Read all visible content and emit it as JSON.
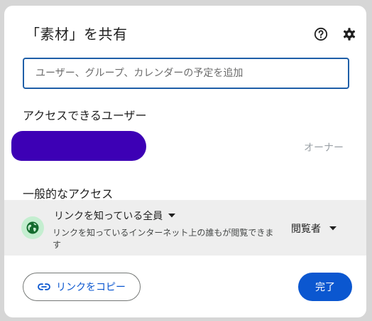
{
  "dialog": {
    "title": "「素材」を共有",
    "help_icon": "help-circle-icon",
    "settings_icon": "gear-icon"
  },
  "share_input": {
    "placeholder": "ユーザー、グループ、カレンダーの予定を追加",
    "value": ""
  },
  "people_section": {
    "heading": "アクセスできるユーザー",
    "owner_role": "オーナー"
  },
  "general_access": {
    "heading": "一般的なアクセス",
    "scope_label": "リンクを知っている全員",
    "scope_description": "リンクを知っているインターネット上の誰もが閲覧できます",
    "role_label": "閲覧者",
    "icon": "globe-icon"
  },
  "footer": {
    "copy_link_label": "リンクをコピー",
    "done_label": "完了"
  },
  "colors": {
    "accent": "#0b57d0",
    "input_border": "#1f5fa8",
    "globe_bg": "#c4eed0",
    "globe_fg": "#146c2e",
    "redaction": "#3d00b5"
  }
}
